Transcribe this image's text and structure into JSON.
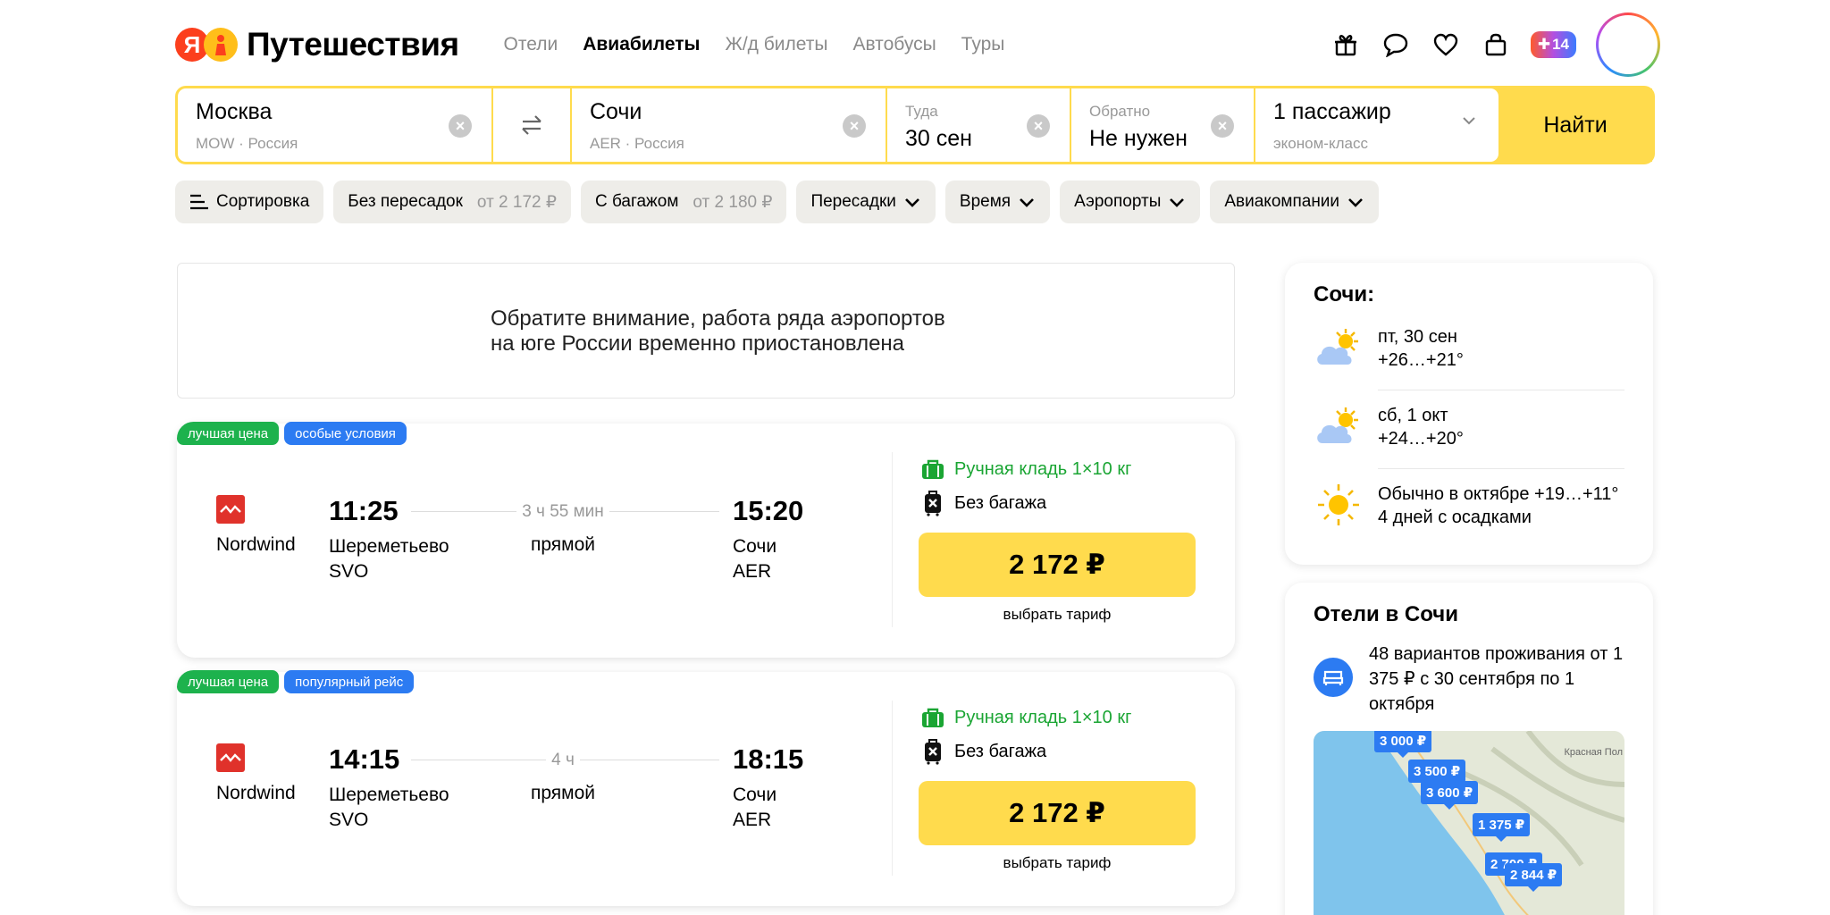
{
  "header": {
    "logo_ya": "Я",
    "logo_text": "Путешествия",
    "nav": [
      {
        "label": "Отели",
        "active": false
      },
      {
        "label": "Авиабилеты",
        "active": true
      },
      {
        "label": "Ж/д билеты",
        "active": false
      },
      {
        "label": "Автобусы",
        "active": false
      },
      {
        "label": "Туры",
        "active": false
      }
    ],
    "plus_count": "14"
  },
  "search": {
    "from_city": "Москва",
    "from_sub": "MOW · Россия",
    "to_city": "Сочи",
    "to_sub": "AER · Россия",
    "date_label": "Туда",
    "date_value": "30 сен",
    "return_label": "Обратно",
    "return_value": "Не нужен",
    "passengers": "1 пассажир",
    "class": "эконом-класс",
    "find_label": "Найти"
  },
  "filters": {
    "sort": "Сортировка",
    "direct": "Без пересадок",
    "direct_price": "от 2 172 ₽",
    "baggage": "С багажом",
    "baggage_price": "от 2 180 ₽",
    "transfers": "Пересадки",
    "time": "Время",
    "airports": "Аэропорты",
    "airlines": "Авиакомпании"
  },
  "notice": {
    "line1": "Обратите внимание, работа ряда аэропортов",
    "line2": "на юге России временно приостановлена"
  },
  "flights": [
    {
      "tag1": "лучшая цена",
      "tag2": "особые условия",
      "airline": "Nordwind",
      "dep_time": "11:25",
      "dep_airport": "Шереметьево",
      "dep_code": "SVO",
      "duration": "3 ч 55 мин",
      "stops": "прямой",
      "arr_time": "15:20",
      "arr_city": "Сочи",
      "arr_code": "AER",
      "hand_luggage": "Ручная кладь 1×10 кг",
      "baggage": "Без багажа",
      "price": "2 172 ₽",
      "tariff": "выбрать тариф"
    },
    {
      "tag1": "лучшая цена",
      "tag2": "популярный рейс",
      "airline": "Nordwind",
      "dep_time": "14:15",
      "dep_airport": "Шереметьево",
      "dep_code": "SVO",
      "duration": "4 ч",
      "stops": "прямой",
      "arr_time": "18:15",
      "arr_city": "Сочи",
      "arr_code": "AER",
      "hand_luggage": "Ручная кладь 1×10 кг",
      "baggage": "Без багажа",
      "price": "2 172 ₽",
      "tariff": "выбрать тариф"
    }
  ],
  "weather": {
    "title": "Сочи:",
    "days": [
      {
        "date": "пт, 30 сен",
        "temp": "+26…+21°",
        "icon": "partly-cloudy-icon"
      },
      {
        "date": "сб, 1 окт",
        "temp": "+24…+20°",
        "icon": "partly-cloudy-icon"
      },
      {
        "date": "Обычно в октябре +19…+11°",
        "temp": "4 дней с осадками",
        "icon": "sun-icon"
      }
    ]
  },
  "hotels": {
    "title": "Отели в Сочи",
    "text": "48 вариантов проживания от 1 375 ₽ с 30 сентября по 1 октября",
    "map_label": "Красная Пол",
    "pins": [
      "3 000 ₽",
      "3 500 ₽",
      "3 600 ₽",
      "1 375 ₽",
      "2 700 ₽",
      "2 844 ₽"
    ]
  },
  "colors": {
    "accent": "#ffdb4d",
    "tag_green": "#1db24d",
    "tag_blue": "#2c7bf2",
    "luggage_green": "#1aa533",
    "airline_red": "#e0322b"
  }
}
